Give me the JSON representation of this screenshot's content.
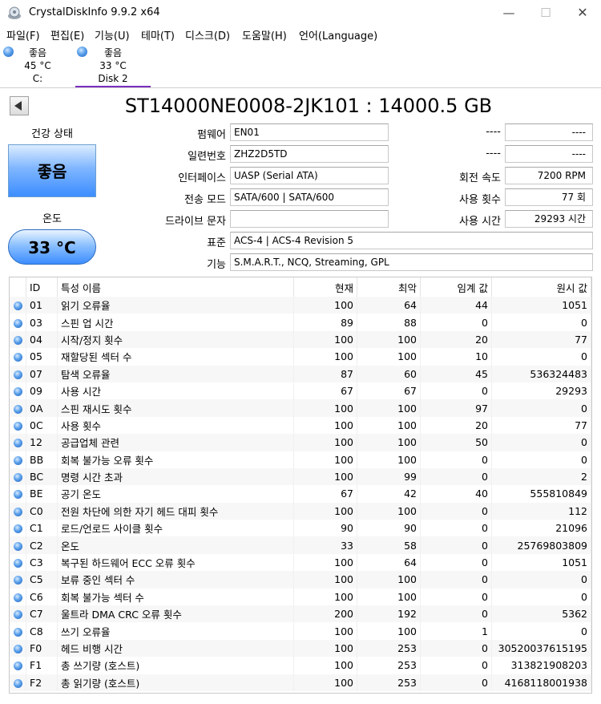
{
  "window": {
    "title": "CrystalDiskInfo 9.9.2 x64"
  },
  "menu": [
    "파일(F)",
    "편집(E)",
    "기능(U)",
    "테마(T)",
    "디스크(D)",
    "도움말(H)",
    "언어(Language)"
  ],
  "disks": [
    {
      "status": "좋음",
      "temp": "45 °C",
      "name": "C:"
    },
    {
      "status": "좋음",
      "temp": "33 °C",
      "name": "Disk 2"
    }
  ],
  "drive": {
    "title": "ST14000NE0008-2JK101 : 14000.5 GB"
  },
  "health": {
    "label": "건강 상태",
    "status": "좋음"
  },
  "temperature": {
    "label": "온도",
    "value": "33 °C"
  },
  "info": {
    "firmware_label": "펌웨어",
    "firmware": "EN01",
    "serial_label": "일련번호",
    "serial": "ZHZ2D5TD",
    "interface_label": "인터페이스",
    "interface": "UASP (Serial ATA)",
    "transfer_label": "전송 모드",
    "transfer": "SATA/600 | SATA/600",
    "drive_letter_label": "드라이브 문자",
    "drive_letter": "",
    "standard_label": "표준",
    "standard": "ACS-4 | ACS-4 Revision 5",
    "features_label": "기능",
    "features": "S.M.A.R.T., NCQ, Streaming, GPL",
    "blank1_label": "----",
    "blank1": "----",
    "blank2_label": "----",
    "blank2": "----",
    "rotation_label": "회전 속도",
    "rotation": "7200 RPM",
    "power_count_label": "사용 횟수",
    "power_count": "77 회",
    "power_hours_label": "사용 시간",
    "power_hours": "29293 시간"
  },
  "table": {
    "headers": [
      "ID",
      "특성 이름",
      "현재",
      "최악",
      "임계 값",
      "원시 값"
    ],
    "rows": [
      [
        "01",
        "읽기 오류율",
        "100",
        "64",
        "44",
        "1051"
      ],
      [
        "03",
        "스핀 업 시간",
        "89",
        "88",
        "0",
        "0"
      ],
      [
        "04",
        "시작/정지 횟수",
        "100",
        "100",
        "20",
        "77"
      ],
      [
        "05",
        "재할당된 섹터 수",
        "100",
        "100",
        "10",
        "0"
      ],
      [
        "07",
        "탐색 오류율",
        "87",
        "60",
        "45",
        "536324483"
      ],
      [
        "09",
        "사용 시간",
        "67",
        "67",
        "0",
        "29293"
      ],
      [
        "0A",
        "스핀 재시도 횟수",
        "100",
        "100",
        "97",
        "0"
      ],
      [
        "0C",
        "사용 횟수",
        "100",
        "100",
        "20",
        "77"
      ],
      [
        "12",
        "공급업체 관련",
        "100",
        "100",
        "50",
        "0"
      ],
      [
        "BB",
        "회복 불가능 오류 횟수",
        "100",
        "100",
        "0",
        "0"
      ],
      [
        "BC",
        "명령 시간 초과",
        "100",
        "99",
        "0",
        "2"
      ],
      [
        "BE",
        "공기 온도",
        "67",
        "42",
        "40",
        "555810849"
      ],
      [
        "C0",
        "전원 차단에 의한 자기 헤드 대피 횟수",
        "100",
        "100",
        "0",
        "112"
      ],
      [
        "C1",
        "로드/언로드 사이클 횟수",
        "90",
        "90",
        "0",
        "21096"
      ],
      [
        "C2",
        "온도",
        "33",
        "58",
        "0",
        "25769803809"
      ],
      [
        "C3",
        "복구된 하드웨어 ECC 오류 횟수",
        "100",
        "64",
        "0",
        "1051"
      ],
      [
        "C5",
        "보류 중인 섹터 수",
        "100",
        "100",
        "0",
        "0"
      ],
      [
        "C6",
        "회복 불가능 섹터 수",
        "100",
        "100",
        "0",
        "0"
      ],
      [
        "C7",
        "울트라 DMA CRC 오류 횟수",
        "200",
        "192",
        "0",
        "5362"
      ],
      [
        "C8",
        "쓰기 오류율",
        "100",
        "100",
        "1",
        "0"
      ],
      [
        "F0",
        "헤드 비행 시간",
        "100",
        "253",
        "0",
        "30520037615195"
      ],
      [
        "F1",
        "총 쓰기량 (호스트)",
        "100",
        "253",
        "0",
        "313821908203"
      ],
      [
        "F2",
        "총 읽기량 (호스트)",
        "100",
        "253",
        "0",
        "4168118001938"
      ]
    ]
  }
}
